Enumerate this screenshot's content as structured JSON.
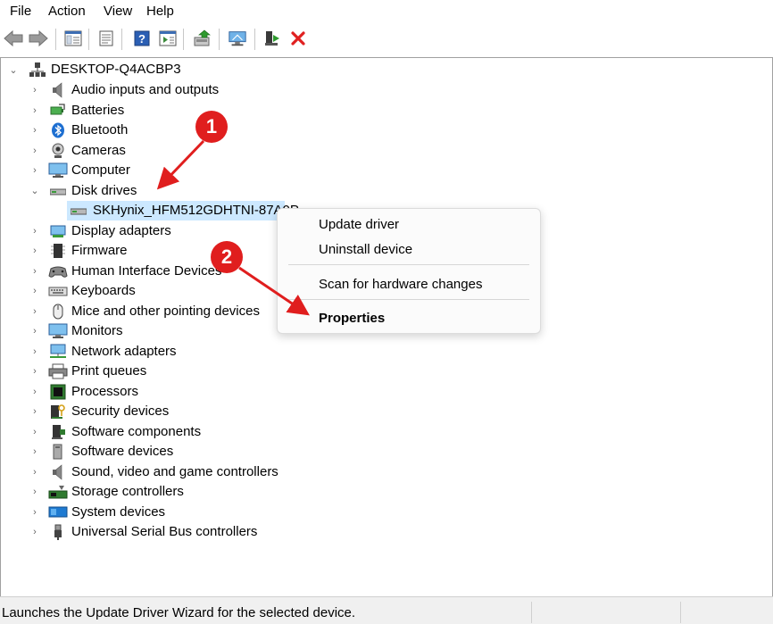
{
  "menubar": {
    "items": [
      {
        "label": "File"
      },
      {
        "label": "Action"
      },
      {
        "label": "View"
      },
      {
        "label": "Help"
      }
    ]
  },
  "toolbar": {
    "buttons": [
      {
        "icon": "back-arrow-icon"
      },
      {
        "icon": "forward-arrow-icon"
      },
      {
        "icon": "show-hide-console-tree-icon"
      },
      {
        "icon": "properties-icon"
      },
      {
        "icon": "help-icon"
      },
      {
        "icon": "action-pane-icon"
      },
      {
        "icon": "update-driver-icon"
      },
      {
        "icon": "scan-hardware-icon"
      },
      {
        "icon": "enable-device-icon"
      },
      {
        "icon": "uninstall-x-icon"
      }
    ]
  },
  "tree": {
    "root": {
      "label": "DESKTOP-Q4ACBP3",
      "icon": "computer-tree-icon"
    },
    "categories": [
      {
        "label": "Audio inputs and outputs",
        "icon": "speaker-icon"
      },
      {
        "label": "Batteries",
        "icon": "battery-icon"
      },
      {
        "label": "Bluetooth",
        "icon": "bluetooth-icon"
      },
      {
        "label": "Cameras",
        "icon": "camera-icon"
      },
      {
        "label": "Computer",
        "icon": "monitor-icon"
      },
      {
        "label": "Disk drives",
        "icon": "disk-drive-icon",
        "expanded": true
      },
      {
        "label": "SKHynix_HFM512GDHTNI-87A0P",
        "icon": "disk-drive-icon",
        "child": true,
        "selected": true
      },
      {
        "label": "Display adapters",
        "icon": "display-adapter-icon"
      },
      {
        "label": "Firmware",
        "icon": "firmware-icon"
      },
      {
        "label": "Human Interface Devices",
        "icon": "hid-icon"
      },
      {
        "label": "Keyboards",
        "icon": "keyboard-icon"
      },
      {
        "label": "Mice and other pointing devices",
        "icon": "mouse-icon"
      },
      {
        "label": "Monitors",
        "icon": "monitor-icon"
      },
      {
        "label": "Network adapters",
        "icon": "network-icon"
      },
      {
        "label": "Print queues",
        "icon": "printer-icon"
      },
      {
        "label": "Processors",
        "icon": "processor-icon"
      },
      {
        "label": "Security devices",
        "icon": "security-icon"
      },
      {
        "label": "Software components",
        "icon": "software-component-icon"
      },
      {
        "label": "Software devices",
        "icon": "software-device-icon"
      },
      {
        "label": "Sound, video and game controllers",
        "icon": "speaker-icon"
      },
      {
        "label": "Storage controllers",
        "icon": "storage-controller-icon"
      },
      {
        "label": "System devices",
        "icon": "system-device-icon"
      },
      {
        "label": "Universal Serial Bus controllers",
        "icon": "usb-icon"
      }
    ]
  },
  "context_menu": {
    "items": [
      {
        "label": "Update driver"
      },
      {
        "label": "Uninstall device"
      },
      {
        "label": "Scan for hardware changes"
      },
      {
        "label": "Properties",
        "bold": true
      }
    ]
  },
  "annotations": {
    "marker1": "1",
    "marker2": "2",
    "color": "#e01e1e"
  },
  "statusbar": {
    "text": "Launches the Update Driver Wizard for the selected device."
  },
  "colors": {
    "selection": "#cce8ff",
    "accent": "#1a73e8"
  }
}
